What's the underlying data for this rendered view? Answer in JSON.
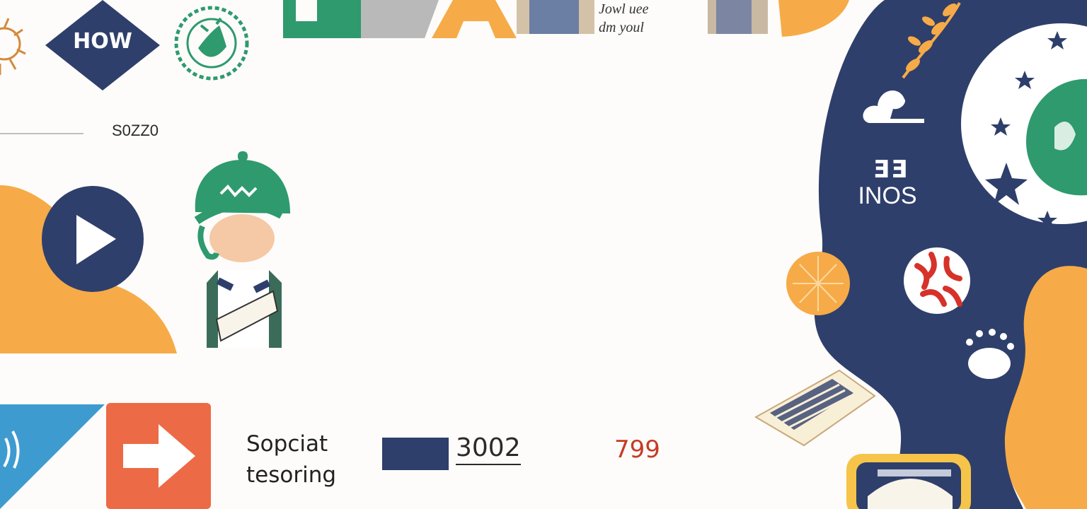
{
  "badge": {
    "label": "HOW"
  },
  "small_number": "S0ZZ0",
  "top_caption": {
    "line1": "Jowl uee",
    "line2": "dm youl"
  },
  "side_label": {
    "top": "ƎƎ",
    "bottom": "INOS"
  },
  "footer": {
    "label_line1": "Sopciat",
    "label_line2": "tesoring",
    "year": "3002",
    "number": "799"
  },
  "colors": {
    "navy": "#2f3f6b",
    "orange": "#f6ab48",
    "green": "#2e9a6e",
    "red_orange": "#ec6a45",
    "blue": "#3e9bd0",
    "gray": "#b9b9b9"
  },
  "icons": [
    "sun-emblem-icon",
    "green-seal-icon",
    "play-icon",
    "arrow-right-icon",
    "laurel-icon",
    "cloud-icon",
    "star-icon",
    "globe-icon",
    "sun-slice-icon",
    "red-pattern-icon",
    "paw-icon",
    "newspaper-icon",
    "mailbox-icon"
  ]
}
